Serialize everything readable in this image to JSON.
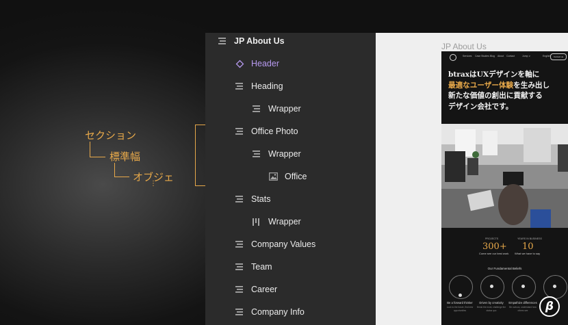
{
  "annotation": {
    "section": "セクション",
    "standard_width": "標準幅",
    "object": "オブジェ",
    "more": "⋮"
  },
  "layers": [
    {
      "label": "JP About Us",
      "icon": "section-lines-icon",
      "level": 0
    },
    {
      "label": "Header",
      "icon": "component-diamond-icon",
      "level": 1
    },
    {
      "label": "Heading",
      "icon": "section-lines-icon",
      "level": 1
    },
    {
      "label": "Wrapper",
      "icon": "section-lines-icon",
      "level": 2
    },
    {
      "label": "Office Photo",
      "icon": "section-lines-icon",
      "level": 1
    },
    {
      "label": "Wrapper",
      "icon": "section-lines-icon",
      "level": 2
    },
    {
      "label": "Office",
      "icon": "image-icon",
      "level": 3
    },
    {
      "label": "Stats",
      "icon": "section-lines-icon",
      "level": 1
    },
    {
      "label": "Wrapper",
      "icon": "columns-icon",
      "level": 2
    },
    {
      "label": "Company Values",
      "icon": "section-lines-icon",
      "level": 1
    },
    {
      "label": "Team",
      "icon": "section-lines-icon",
      "level": 1
    },
    {
      "label": "Career",
      "icon": "section-lines-icon",
      "level": 1
    },
    {
      "label": "Company Info",
      "icon": "section-lines-icon",
      "level": 1
    }
  ],
  "canvas": {
    "frame_title": "JP About Us",
    "nav_items": [
      "Services",
      "Case Studies",
      "Blog",
      "About",
      "Contact",
      "Jump ∨",
      "English"
    ],
    "nav_cta": "Contact us",
    "hero_line1": "btraxはUXデザインを軸に",
    "hero_line2_accent": "最適なユーザー体験",
    "hero_line2_rest": "を生み出し",
    "hero_line3": "新たな価値の創出に貢献する",
    "hero_line4": "デザイン会社です。",
    "stats": [
      {
        "label": "PROJECTS",
        "value": "300+",
        "sub": "Come see our best work"
      },
      {
        "label": "YEARS IN BUSINESS",
        "value": "10",
        "sub": "What we have to say"
      }
    ],
    "beliefs_title": "Our Fundamental Beliefs",
    "beliefs": [
      {
        "title": "Be a forward thinker",
        "sub": "Look to the future, find new opportunities"
      },
      {
        "title": "Driven by creativity",
        "sub": "Break the mold, challenge the status quo"
      },
      {
        "title": "Empathize differences",
        "sub": "Be curious, understand how others see"
      },
      {
        "title": "Em",
        "sub": ""
      }
    ]
  },
  "colors": {
    "accent": "#e8a94a",
    "header_purple": "#b79af0",
    "panel_bg": "#2b2b2b",
    "canvas_bg": "#efefef"
  }
}
